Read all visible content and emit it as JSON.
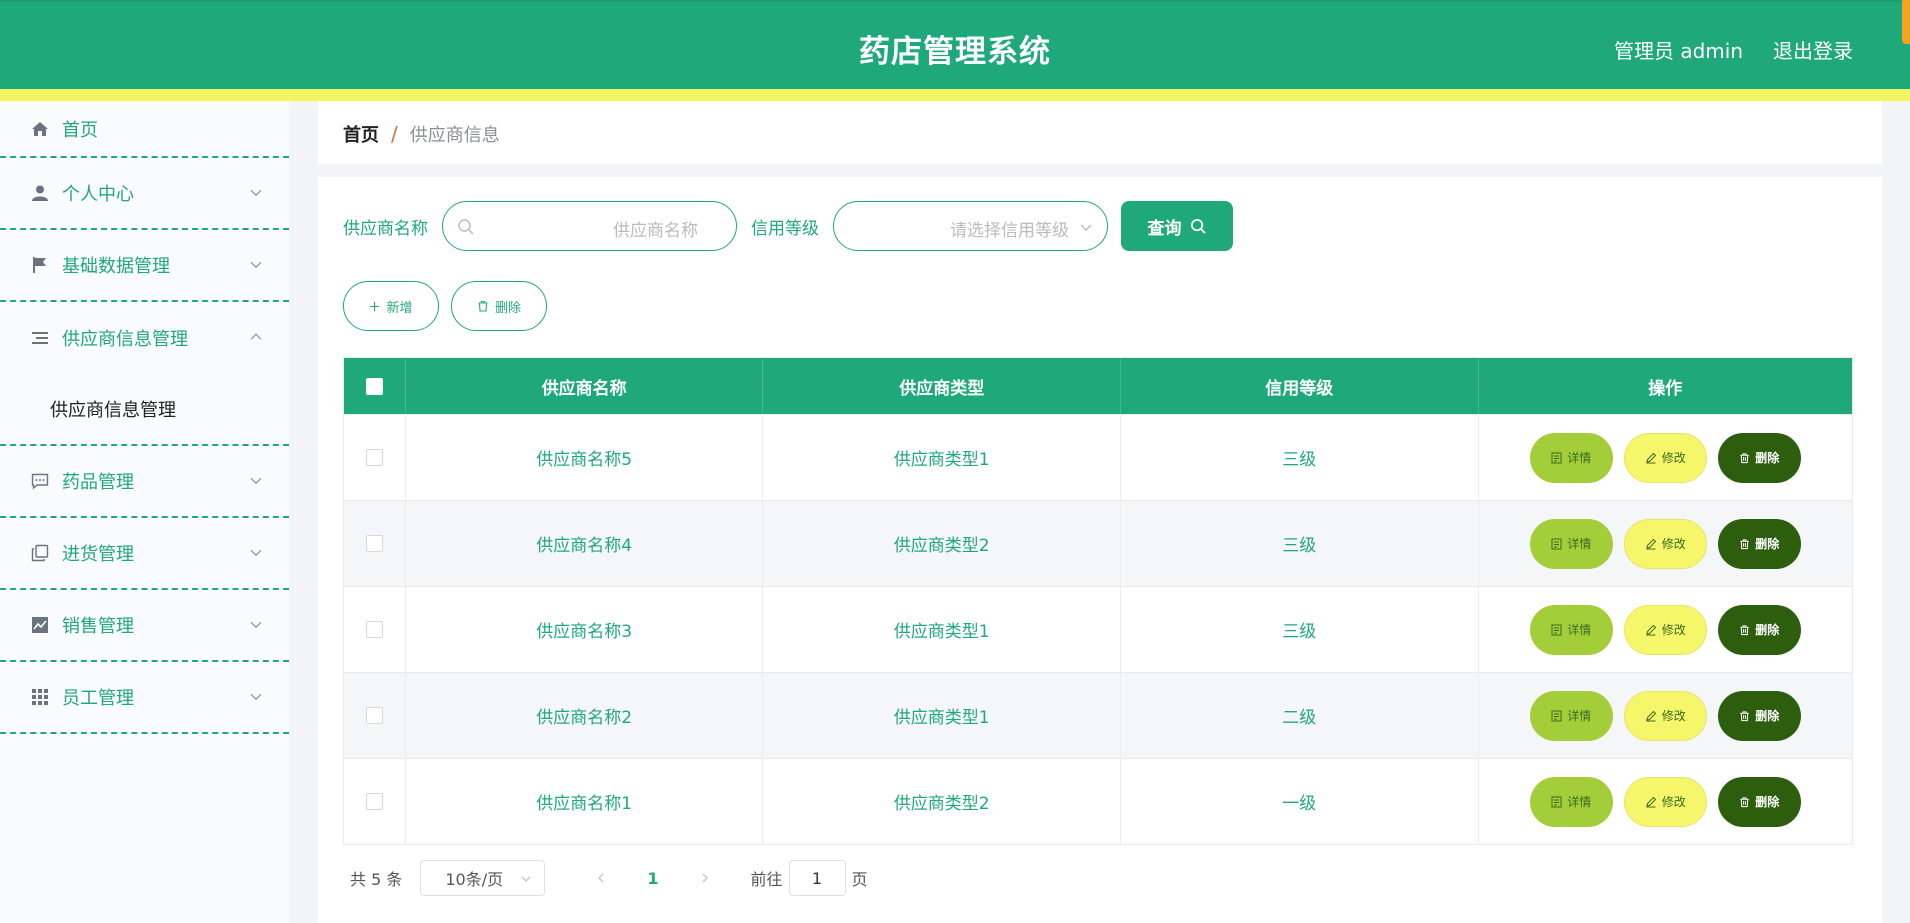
{
  "header": {
    "title": "药店管理系统",
    "user_label": "管理员 admin",
    "logout_label": "退出登录"
  },
  "sidebar": {
    "items": [
      {
        "label": "首页",
        "icon": "home-icon"
      },
      {
        "label": "个人中心",
        "icon": "user-icon"
      },
      {
        "label": "基础数据管理",
        "icon": "flag-icon"
      },
      {
        "label": "供应商信息管理",
        "icon": "list-icon",
        "expanded": true,
        "children": [
          "供应商信息管理"
        ]
      },
      {
        "label": "药品管理",
        "icon": "message-icon"
      },
      {
        "label": "进货管理",
        "icon": "copy-icon"
      },
      {
        "label": "销售管理",
        "icon": "chart-icon"
      },
      {
        "label": "员工管理",
        "icon": "grid-icon"
      }
    ]
  },
  "breadcrumb": {
    "home": "首页",
    "separator": "/",
    "current": "供应商信息"
  },
  "search": {
    "name_label": "供应商名称",
    "name_placeholder": "供应商名称",
    "credit_label": "信用等级",
    "credit_placeholder": "请选择信用等级",
    "query_label": "查询"
  },
  "actions": {
    "add_label": "新增",
    "delete_label": "删除"
  },
  "table": {
    "columns": [
      "供应商名称",
      "供应商类型",
      "信用等级",
      "操作"
    ],
    "rows": [
      {
        "name": "供应商名称5",
        "type": "供应商类型1",
        "credit": "三级"
      },
      {
        "name": "供应商名称4",
        "type": "供应商类型2",
        "credit": "三级"
      },
      {
        "name": "供应商名称3",
        "type": "供应商类型1",
        "credit": "三级"
      },
      {
        "name": "供应商名称2",
        "type": "供应商类型1",
        "credit": "二级"
      },
      {
        "name": "供应商名称1",
        "type": "供应商类型2",
        "credit": "一级"
      }
    ],
    "op_detail": "详情",
    "op_edit": "修改",
    "op_delete": "删除"
  },
  "pagination": {
    "total": "共 5 条",
    "page_size": "10条/页",
    "current_page": "1",
    "goto_prefix": "前往",
    "goto_value": "1",
    "goto_suffix": "页"
  },
  "colors": {
    "primary": "#1fa97a",
    "yellow_strip": "#f3f562",
    "detail_btn": "#a4cd3a",
    "edit_btn": "#f6f66a",
    "delete_btn": "#2d5e0e"
  }
}
